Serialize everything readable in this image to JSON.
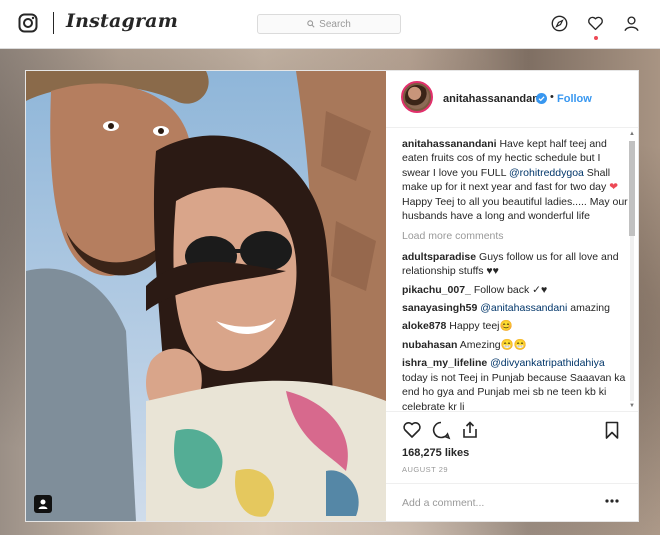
{
  "nav": {
    "brand": "Instagram",
    "search_placeholder": "Search",
    "icons": [
      "instagram-camera-icon",
      "compass-icon",
      "heart-icon",
      "profile-icon"
    ]
  },
  "post": {
    "username": "anitahassanandani",
    "follow_separator": "•",
    "follow_label": "Follow",
    "caption": {
      "user": "anitahassanandani",
      "text_before_mention": "Have kept half teej and eaten fruits cos of my hectic schedule but I swear I love you FULL ",
      "mention": "@rohitreddygoa",
      "text_after_mention": " Shall make up for it next year and fast for two day ",
      "heart": "❤",
      "text_end": " Happy Teej to all you beautiful ladies..... May our husbands have a long and wonderful life"
    },
    "load_more": "Load more comments",
    "comments": [
      {
        "user": "adultsparadise",
        "mention": "",
        "text": "Guys follow us for all love and relationship stuffs ♥♥"
      },
      {
        "user": "pikachu_007_",
        "mention": "",
        "text": "Follow back ✓♥"
      },
      {
        "user": "sanayasingh59",
        "mention": "@anitahassandani",
        "text": " amazing"
      },
      {
        "user": "aloke878",
        "mention": "",
        "text": "Happy teej😊"
      },
      {
        "user": "nubahasan",
        "mention": "",
        "text": "Amezing😁😁"
      },
      {
        "user": "ishra_my_lifeline",
        "mention": "@divyankatripathidahiya",
        "text": " today is not Teej in Punjab because Saaavan ka end ho gya and Punjab mei sb ne teen kb ki celebrate kr li"
      }
    ],
    "likes": "168,275 likes",
    "date": "AUGUST 29",
    "add_comment_placeholder": "Add a comment...",
    "colors": {
      "link": "#003569",
      "follow": "#3897f0",
      "heart": "#ed4956",
      "muted": "#999999"
    }
  }
}
